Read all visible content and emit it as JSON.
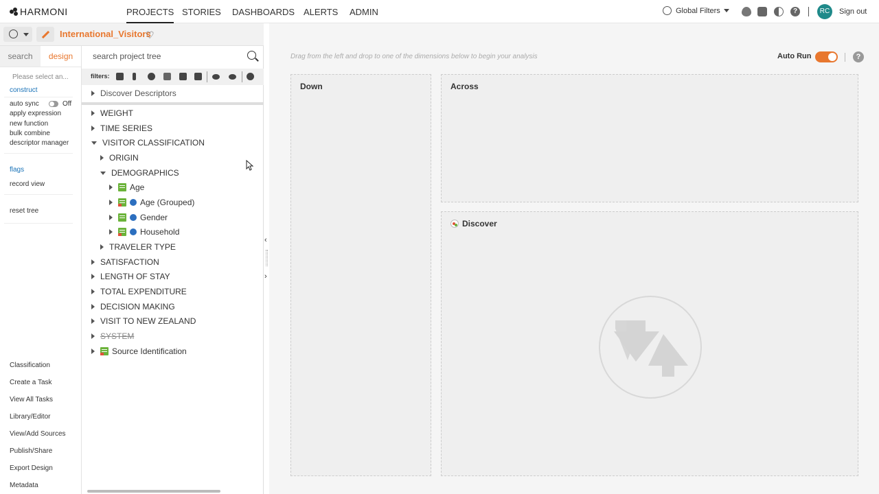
{
  "app": {
    "brand": "HARMONI",
    "nav": [
      "PROJECTS",
      "STORIES",
      "DASHBOARDS",
      "ALERTS",
      "ADMIN"
    ],
    "global_filters": "Global Filters",
    "user_initials": "RC",
    "sign_out": "Sign out"
  },
  "project": {
    "title": "International_Visitors"
  },
  "left": {
    "tabs": [
      "search",
      "design"
    ],
    "select_placeholder": "Please select an...",
    "construct": "construct",
    "auto_sync": "auto sync",
    "auto_sync_state": "Off",
    "actions": [
      "apply expression",
      "new function",
      "bulk combine",
      "descriptor manager"
    ],
    "flags": "flags",
    "record_view": "record view",
    "reset_tree": "reset tree",
    "bottom": [
      "Classification",
      "Create a Task",
      "View All Tasks",
      "Library/Editor",
      "View/Add Sources",
      "Publish/Share",
      "Export Design",
      "Metadata"
    ]
  },
  "tree": {
    "search_placeholder": "search project tree",
    "filters_label": "filters:",
    "top_item": "Discover Descriptors",
    "nodes": [
      "WEIGHT",
      "TIME SERIES",
      "VISITOR CLASSIFICATION",
      "ORIGIN",
      "DEMOGRAPHICS",
      "Age",
      "Age (Grouped)",
      "Gender",
      "Household",
      "TRAVELER TYPE",
      "SATISFACTION",
      "LENGTH OF STAY",
      "TOTAL EXPENDITURE",
      "DECISION MAKING",
      "VISIT TO NEW ZEALAND",
      "SYSTEM",
      "Source Identification"
    ]
  },
  "main": {
    "hint": "Drag from the left and drop to one of the dimensions below to begin your analysis",
    "auto_run": "Auto Run",
    "down": "Down",
    "across": "Across",
    "discover": "Discover"
  },
  "colors": {
    "accent": "#e8772e",
    "link": "#1a73b8",
    "avatar": "#1f8a8a"
  }
}
